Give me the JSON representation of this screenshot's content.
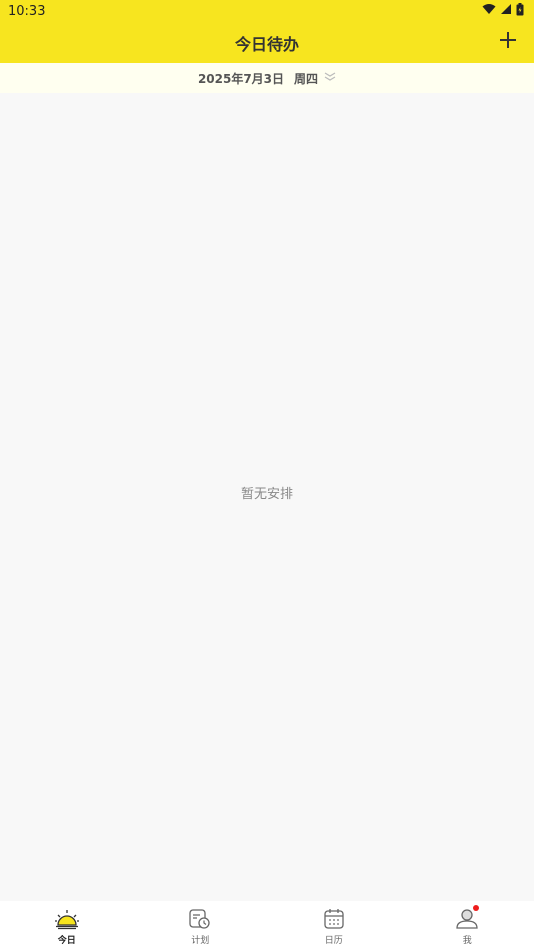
{
  "status_bar": {
    "time": "10:33",
    "icons": [
      "wifi-icon",
      "signal-icon",
      "battery-icon"
    ]
  },
  "header": {
    "title": "今日待办",
    "add_icon": "plus-icon"
  },
  "date_bar": {
    "date": "2025年7月3日",
    "weekday": "周四",
    "expand_icon": "double-chevron-down-icon"
  },
  "main": {
    "empty_text": "暂无安排"
  },
  "tab_bar": {
    "tabs": [
      {
        "label": "今日",
        "icon": "sun-icon",
        "active": true
      },
      {
        "label": "计划",
        "icon": "plan-clock-icon",
        "active": false
      },
      {
        "label": "日历",
        "icon": "calendar-icon",
        "active": false
      },
      {
        "label": "我",
        "icon": "user-icon",
        "active": false,
        "badge": true
      }
    ]
  },
  "colors": {
    "accent": "#f7e51f",
    "background": "#f8f8f8",
    "date_bar_bg": "#fffff0",
    "badge": "#ee1c1c"
  }
}
